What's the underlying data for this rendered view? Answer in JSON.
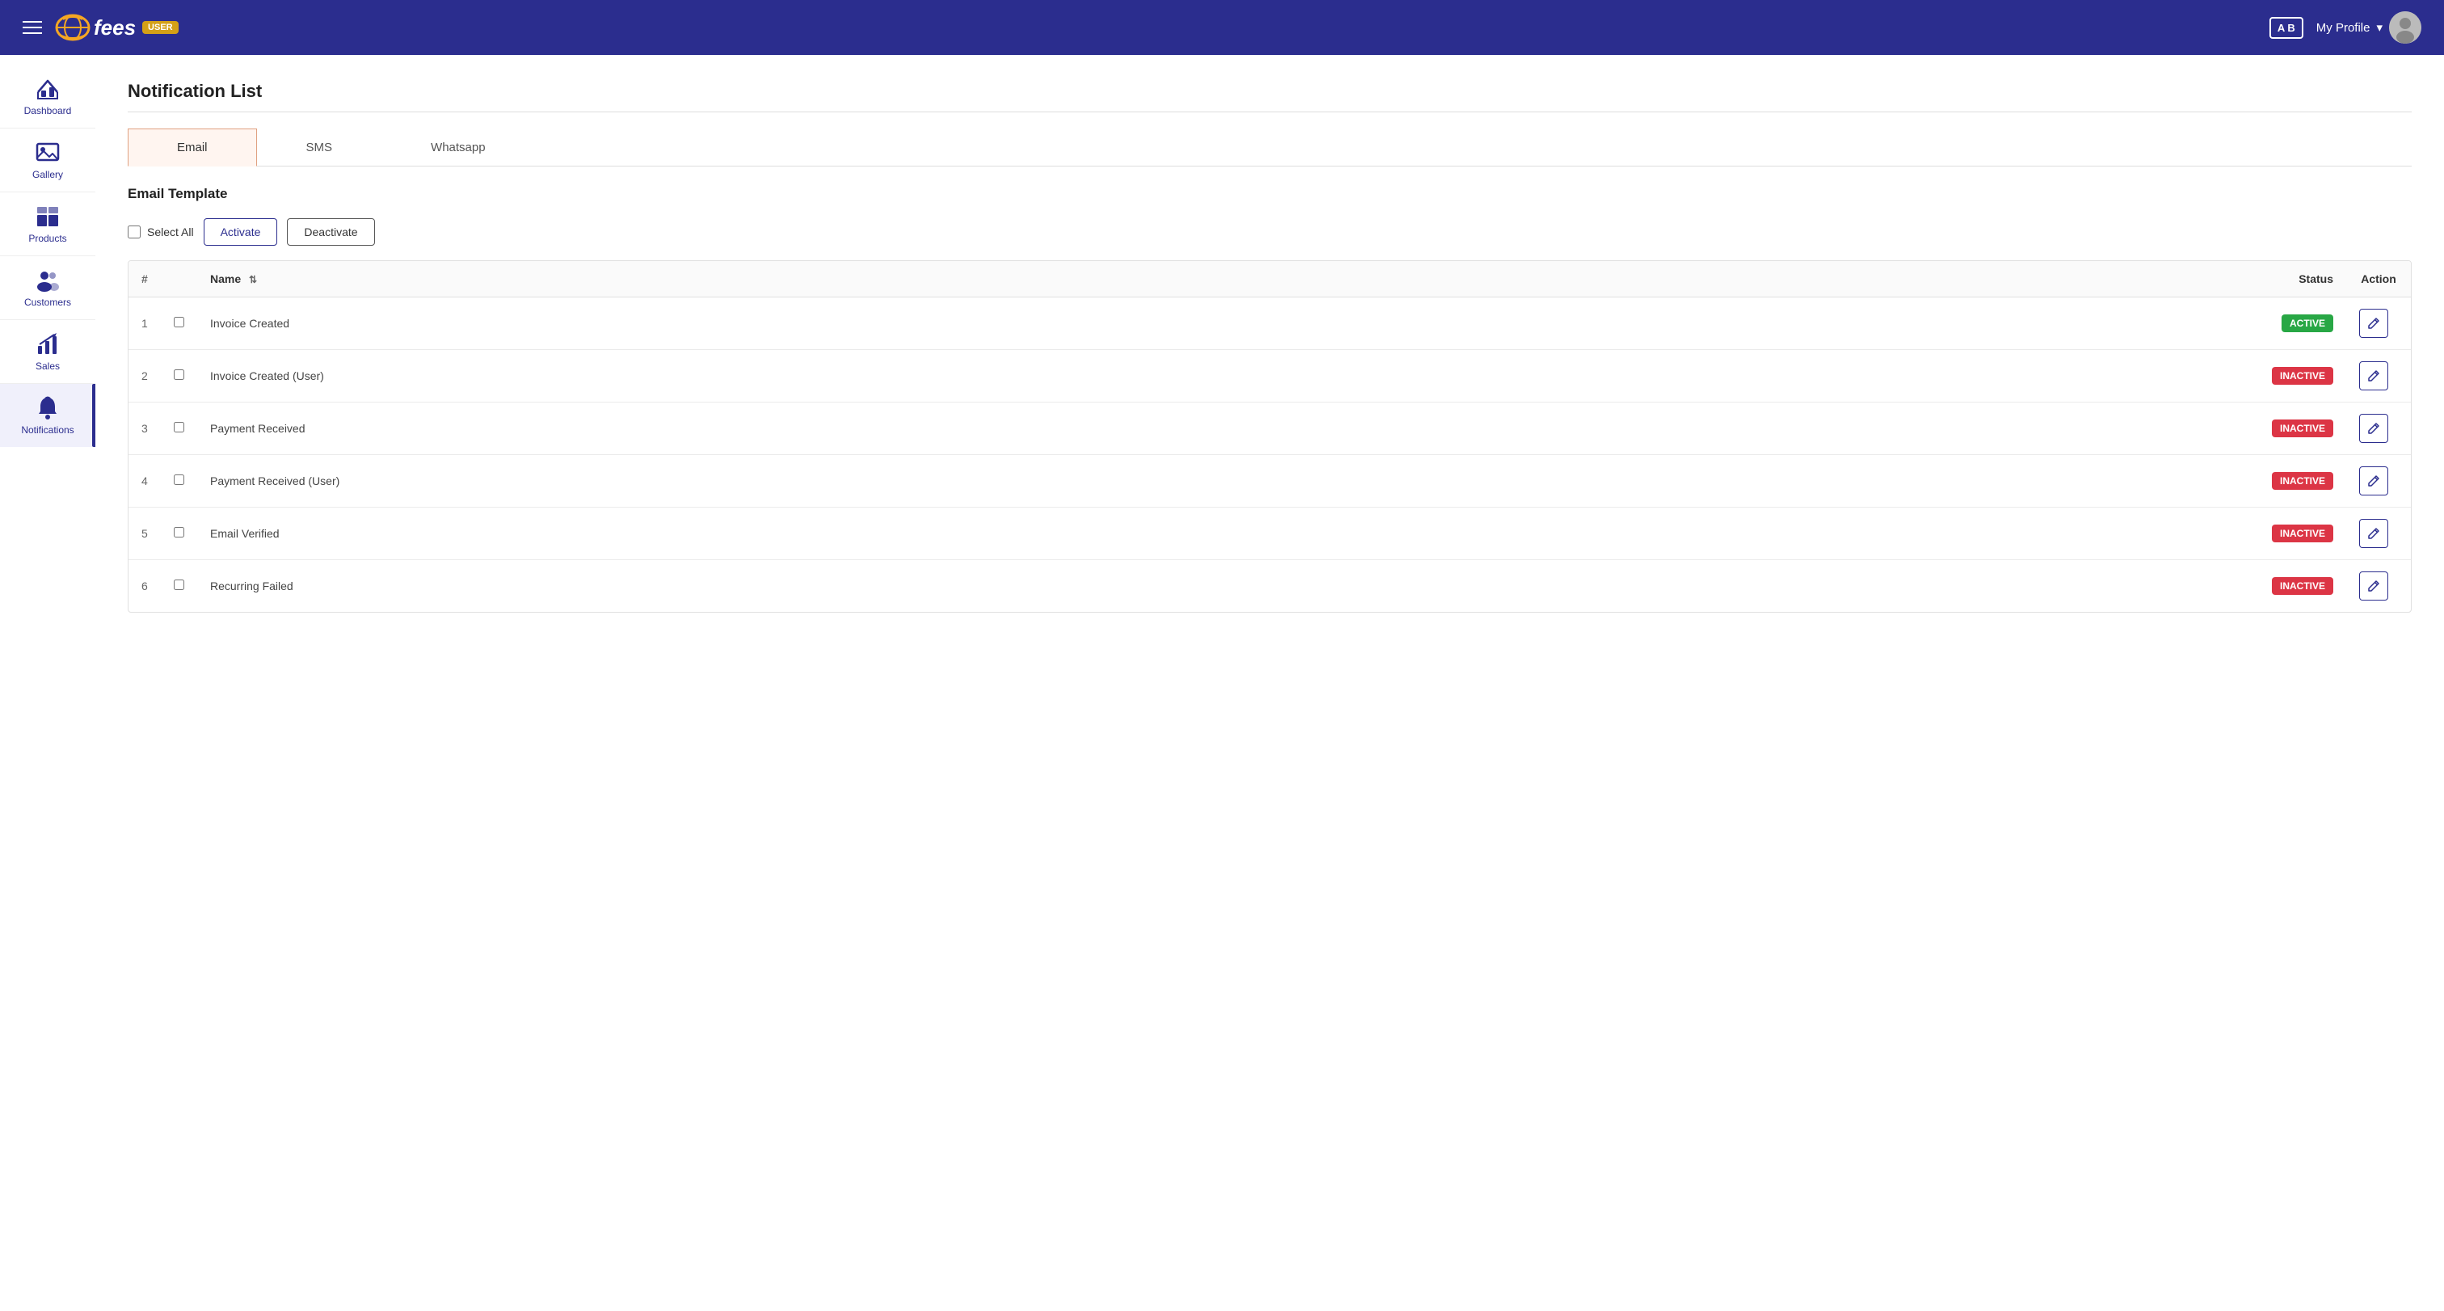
{
  "header": {
    "menu_label": "Menu",
    "logo_text": "fees",
    "logo_badge": "USER",
    "lang_badge": "A B",
    "profile_label": "My Profile",
    "profile_caret": "▾"
  },
  "sidebar": {
    "items": [
      {
        "id": "dashboard",
        "label": "Dashboard",
        "icon": "dashboard"
      },
      {
        "id": "gallery",
        "label": "Gallery",
        "icon": "gallery"
      },
      {
        "id": "products",
        "label": "Products",
        "icon": "products"
      },
      {
        "id": "customers",
        "label": "Customers",
        "icon": "customers"
      },
      {
        "id": "sales",
        "label": "Sales",
        "icon": "sales"
      },
      {
        "id": "notifications",
        "label": "Notifications",
        "icon": "notifications",
        "active": true
      }
    ]
  },
  "page": {
    "title": "Notification List",
    "tabs": [
      {
        "id": "email",
        "label": "Email",
        "active": true
      },
      {
        "id": "sms",
        "label": "SMS",
        "active": false
      },
      {
        "id": "whatsapp",
        "label": "Whatsapp",
        "active": false
      }
    ],
    "section_title": "Email Template",
    "select_all_label": "Select All",
    "activate_label": "Activate",
    "deactivate_label": "Deactivate",
    "table": {
      "columns": [
        {
          "id": "num",
          "label": "#"
        },
        {
          "id": "checkbox",
          "label": ""
        },
        {
          "id": "name",
          "label": "Name",
          "sortable": true
        },
        {
          "id": "status",
          "label": "Status"
        },
        {
          "id": "action",
          "label": "Action"
        }
      ],
      "rows": [
        {
          "num": 1,
          "name": "Invoice Created",
          "status": "ACTIVE",
          "status_type": "active"
        },
        {
          "num": 2,
          "name": "Invoice Created (User)",
          "status": "INACTIVE",
          "status_type": "inactive"
        },
        {
          "num": 3,
          "name": "Payment Received",
          "status": "INACTIVE",
          "status_type": "inactive"
        },
        {
          "num": 4,
          "name": "Payment Received (User)",
          "status": "INACTIVE",
          "status_type": "inactive"
        },
        {
          "num": 5,
          "name": "Email Verified",
          "status": "INACTIVE",
          "status_type": "inactive"
        },
        {
          "num": 6,
          "name": "Recurring Failed",
          "status": "INACTIVE",
          "status_type": "inactive"
        }
      ]
    }
  },
  "icons": {
    "dashboard": "🏠",
    "gallery": "🖼",
    "products": "📦",
    "customers": "👥",
    "sales": "📊",
    "notifications": "🔔",
    "edit": "✏"
  }
}
